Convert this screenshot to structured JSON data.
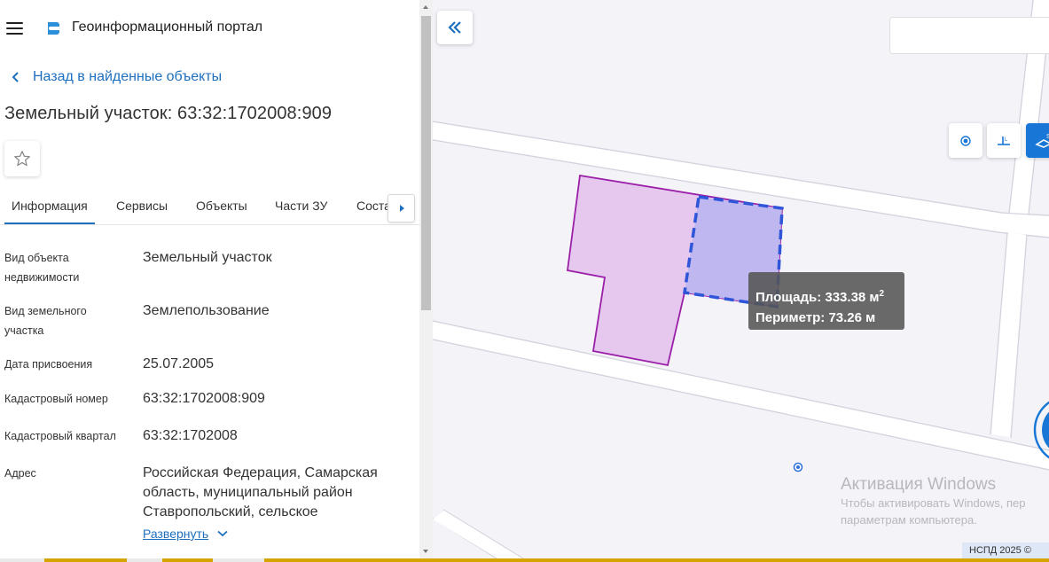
{
  "header": {
    "menu_icon": "hamburger-menu-icon",
    "logo_icon": "portal-logo-icon",
    "app_title": "Геоинформационный портал"
  },
  "nav": {
    "back_label": "Назад в найденные объекты",
    "back_icon": "chevron-left-icon"
  },
  "object": {
    "title": "Земельный участок: 63:32:1702008:909",
    "favorite_icon": "star-icon"
  },
  "tabs": [
    {
      "label": "Информация",
      "active": true
    },
    {
      "label": "Сервисы"
    },
    {
      "label": "Объекты"
    },
    {
      "label": "Части ЗУ"
    },
    {
      "label": "Соста"
    }
  ],
  "info": [
    {
      "label": "Вид объекта недвижимости",
      "value": "Земельный участок"
    },
    {
      "label": "Вид земельного участка",
      "value": "Землепользование"
    },
    {
      "label": "Дата присвоения",
      "value": "25.07.2005"
    },
    {
      "label": "Кадастровый номер",
      "value": "63:32:1702008:909"
    },
    {
      "label": "Кадастровый квартал",
      "value": "63:32:1702008"
    },
    {
      "label": "Адрес",
      "value": "Российская Федерация, Самарская область, муниципальный район Ставропольский, сельское"
    }
  ],
  "expand_label": "Развернуть",
  "map": {
    "collapse_icon": "double-chevron-left-icon",
    "search_placeholder": "",
    "tools": [
      {
        "icon": "point-tool-icon",
        "active": false
      },
      {
        "icon": "length-tool-icon",
        "active": false
      },
      {
        "icon": "area-tool-icon",
        "active": true
      }
    ],
    "measure": {
      "area_label": "Площадь:",
      "area_value": "333.38 м",
      "area_sup": "2",
      "perimeter_label": "Периметр:",
      "perimeter_value": "73.26 м"
    },
    "activation_title": "Активация Windows",
    "activation_line1": "Чтобы активировать Windows, пер",
    "activation_line2": "параметрам компьютера.",
    "copyright": "НСПД 2025 ©",
    "colors": {
      "parcel_fill": "#e6c8ef",
      "parcel_stroke": "#9b1fa8",
      "measure_fill": "#bdb6ee",
      "measure_stroke": "#2f55d9",
      "accent": "#1877d6"
    }
  }
}
